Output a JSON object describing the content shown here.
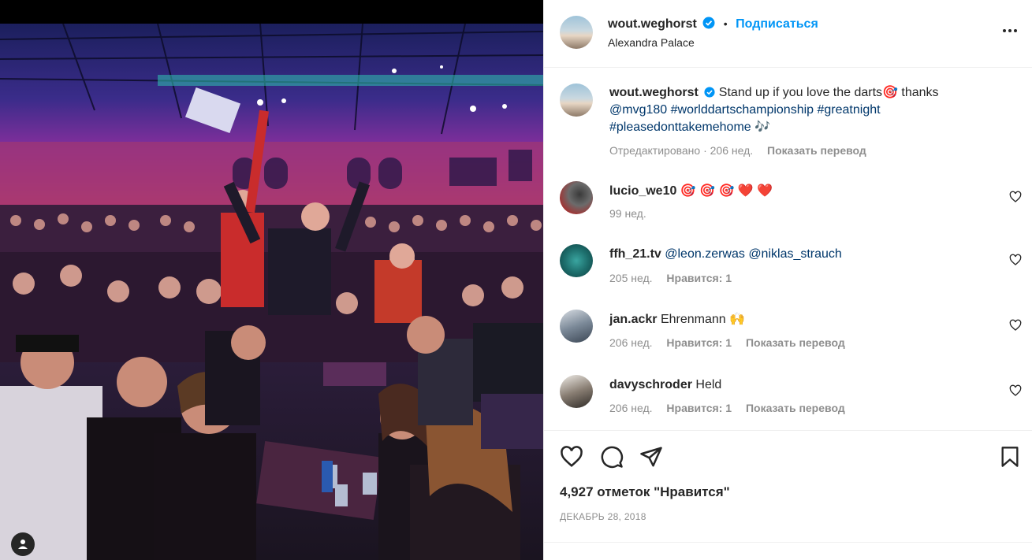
{
  "post": {
    "author": "wout.weghorst",
    "follow_label": "Подписаться",
    "location": "Alexandra Palace",
    "caption_text": "Stand up if you love the darts🎯  thanks",
    "caption_mention": "@mvg180",
    "caption_tags_line1": "#worlddartschampionship #greatnight",
    "caption_tags_line2": "#pleasedonttakemehome",
    "caption_emoji_end": "🎶",
    "edited_label": "Отредактировано · 206 нед.",
    "translate_label": "Показать перевод"
  },
  "comments": [
    {
      "user": "lucio_we10",
      "text": "🎯 🎯 🎯 ❤️ ❤️",
      "time": "99 нед."
    },
    {
      "user": "ffh_21.tv",
      "text": "@leon.zerwas @niklas_strauch",
      "time": "205 нед.",
      "likes": "Нравится: 1"
    },
    {
      "user": "jan.ackr",
      "text": "Ehrenmann 🙌",
      "time": "206 нед.",
      "likes": "Нравится: 1",
      "translate": "Показать перевод"
    },
    {
      "user": "davyschroder",
      "text": "Held",
      "time": "206 нед.",
      "likes": "Нравится: 1",
      "translate": "Показать перевод"
    }
  ],
  "footer": {
    "likes_count": "4,927 отметок \"Нравится\"",
    "date": "ДЕКАБРЬ 28, 2018"
  },
  "icons": [
    "verified-badge-icon",
    "more-options-icon",
    "heart-icon",
    "comment-icon",
    "share-icon",
    "bookmark-icon",
    "user-tag-icon"
  ],
  "colors": {
    "link": "#0095f6",
    "mention": "#00376b",
    "verified": "#0095f6",
    "muted": "#8e8e8e"
  }
}
